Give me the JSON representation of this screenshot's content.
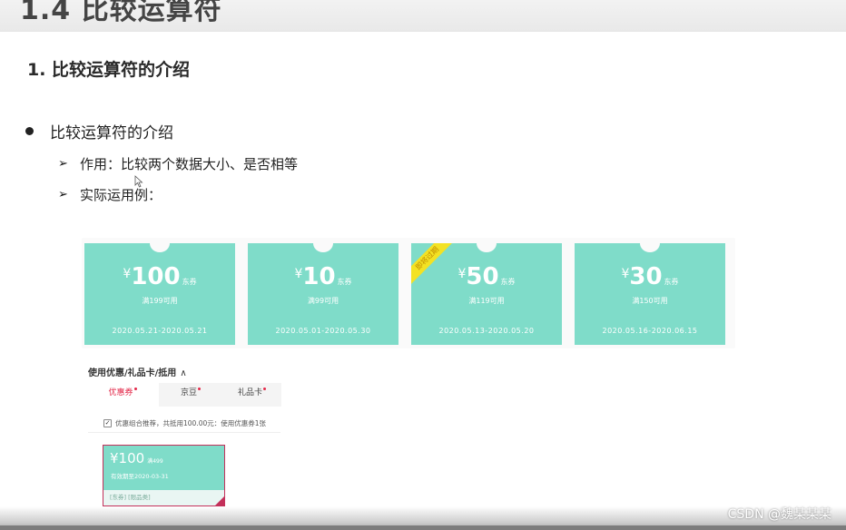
{
  "slide": {
    "title": "1.4 比较运算符",
    "faded_top_text": "— — — —"
  },
  "section": {
    "heading": "1. 比较运算符的介绍",
    "bullet": "比较运算符的介绍",
    "sub_items": [
      {
        "text": "作用：比较两个数据大小、是否相等",
        "icon": "arrow-icon"
      },
      {
        "text": "实际运用例：",
        "icon": "arrow-icon"
      }
    ]
  },
  "coupons": [
    {
      "currency": "¥",
      "amount": "100",
      "unit": "东券",
      "condition": "满199可用",
      "dates": "2020.05.21-2020.05.21",
      "ribbon": ""
    },
    {
      "currency": "¥",
      "amount": "10",
      "unit": "东券",
      "condition": "满99可用",
      "dates": "2020.05.01-2020.05.30",
      "ribbon": ""
    },
    {
      "currency": "¥",
      "amount": "50",
      "unit": "东券",
      "condition": "满119可用",
      "dates": "2020.05.13-2020.05.20",
      "ribbon": "即将过期"
    },
    {
      "currency": "¥",
      "amount": "30",
      "unit": "东券",
      "condition": "满150可用",
      "dates": "2020.05.16-2020.06.15",
      "ribbon": ""
    }
  ],
  "panel": {
    "label": "使用优惠/礼品卡/抵用",
    "chevron": "∧",
    "tabs": [
      "优惠券",
      "京豆",
      "礼品卡"
    ],
    "recommend_text": "优惠组合推荐，共抵用100.00元：使用优惠券1张",
    "mini_coupon": {
      "amount": "¥100",
      "condition": "满499",
      "date": "有效期至2020-03-31",
      "footer": "[东券] [限品类]"
    }
  },
  "watermark": "CSDN @魏某某某",
  "colors": {
    "coupon_green": "#7fdcc9",
    "accent_red": "#e3294a",
    "ribbon_yellow": "#f3e224"
  }
}
